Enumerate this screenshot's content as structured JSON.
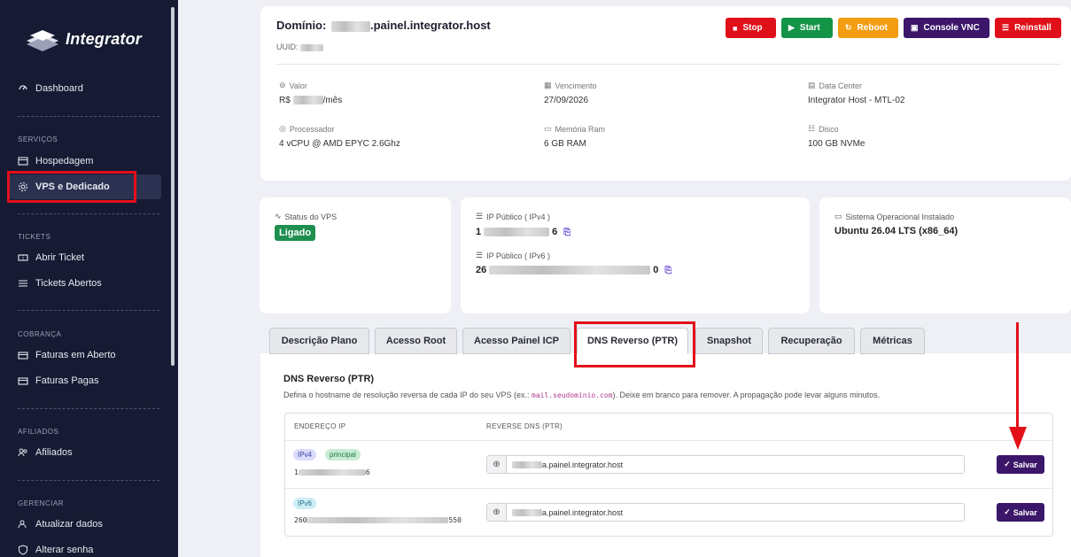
{
  "sidebar": {
    "logo_text": "Integrator",
    "dashboard": "Dashboard",
    "sections": {
      "servicos": "SERVIÇOS",
      "tickets": "TICKETS",
      "cobranca": "COBRANÇA",
      "afiliados": "AFILIADOS",
      "gerenciar": "GERENCIAR"
    },
    "items": {
      "hospedagem": "Hospedagem",
      "vps": "VPS e Dedicado",
      "abrir_ticket": "Abrir Ticket",
      "tickets_abertos": "Tickets Abertos",
      "faturas_aberto": "Faturas em Aberto",
      "faturas_pagas": "Faturas Pagas",
      "afiliados": "Afiliados",
      "atualizar_dados": "Atualizar dados",
      "alterar_senha": "Alterar senha"
    }
  },
  "server": {
    "domain_label": "Domínio:",
    "domain_suffix": ".painel.integrator.host",
    "uuid_label": "UUID:",
    "actions": {
      "stop": "Stop",
      "start": "Start",
      "reboot": "Reboot",
      "console": "Console VNC",
      "reinstall": "Reinstall"
    },
    "info": {
      "valor_label": "Valor",
      "valor_prefix": "R$",
      "valor_suffix": "/mês",
      "vencimento_label": "Vencimento",
      "vencimento_value": "27/09/2026",
      "datacenter_label": "Data Center",
      "datacenter_value": "Integrator Host - MTL-02",
      "processador_label": "Processador",
      "processador_value": "4 vCPU @ AMD EPYC 2.6Ghz",
      "memoria_label": "Memória Ram",
      "memoria_value": "6 GB RAM",
      "disco_label": "Disco",
      "disco_value": "100 GB NVMe"
    }
  },
  "status": {
    "label": "Status do VPS",
    "value": "Ligado"
  },
  "ips": {
    "ipv4_label": "IP Público ( IPv4 )",
    "ipv4_start": "1",
    "ipv4_end": "6",
    "ipv6_label": "IP Público ( IPv6 )",
    "ipv6_start": "26",
    "ipv6_end": "0"
  },
  "os": {
    "label": "Sistema Operacional Instalado",
    "value": "Ubuntu 26.04 LTS (x86_64)"
  },
  "tabs": [
    "Descrição Plano",
    "Acesso Root",
    "Acesso Painel ICP",
    "DNS Reverso (PTR)",
    "Snapshot",
    "Recuperação",
    "Métricas"
  ],
  "dns": {
    "title": "DNS Reverso (PTR)",
    "desc_before": "Defina o hostname de resolução reversa de cada IP do seu VPS (ex.: ",
    "desc_code": "mail.seudominio.com",
    "desc_after": "). Deixe em branco para remover. A propagação pode levar alguns minutos.",
    "col_ip": "ENDEREÇO IP",
    "col_ptr": "REVERSE DNS (PTR)",
    "rows": [
      {
        "badge": "IPv4",
        "badge2": "principal",
        "ip_start": "1",
        "ip_end": "6",
        "ptr_suffix": "a.painel.integrator.host",
        "save": "Salvar"
      },
      {
        "badge": "IPv6",
        "ip_start": "260",
        "ip_end": "550",
        "ptr_suffix": "a.painel.integrator.host",
        "save": "Salvar"
      }
    ]
  },
  "colors": {
    "sidebar_bg": "#161b33",
    "stop": "#e0101a",
    "start": "#139447",
    "reboot": "#f29d12",
    "console": "#3b1669",
    "reinstall": "#e0101a",
    "status_green": "#1e8f4f",
    "annotation_red": "#e3101a"
  }
}
